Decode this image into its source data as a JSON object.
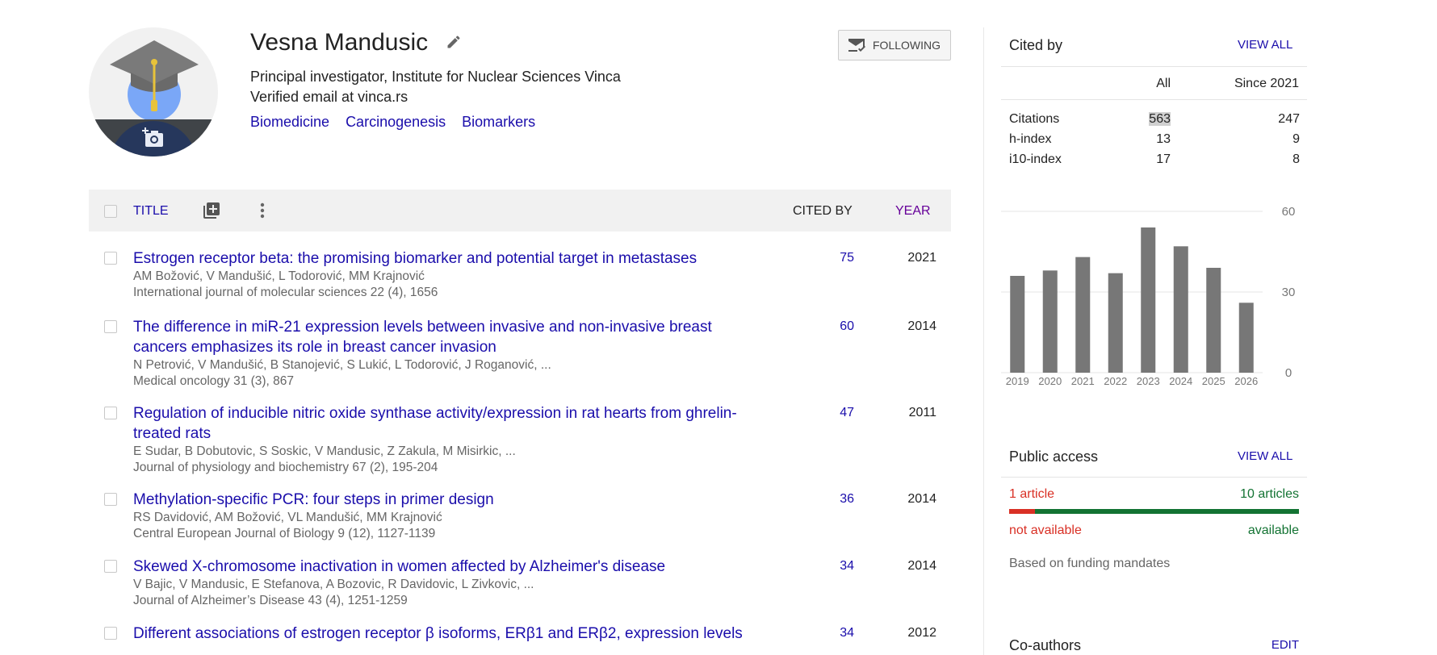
{
  "profile": {
    "name": "Vesna Mandusic",
    "affiliation": "Principal investigator, Institute for Nuclear Sciences Vinca",
    "email": "Verified email at vinca.rs",
    "interests": [
      "Biomedicine",
      "Carcinogenesis",
      "Biomarkers"
    ],
    "follow_label": "FOLLOWING"
  },
  "table": {
    "title_header": "TITLE",
    "cited_by_header": "CITED BY",
    "year_header": "YEAR",
    "rows": [
      {
        "title": [
          "Estrogen receptor beta: the promising biomarker and potential target in metastases"
        ],
        "authors": "AM Božović, V Mandušić, L Todorović, MM Krajnović",
        "venue": "International journal of molecular sciences 22 (4), 1656",
        "cited_by": "75",
        "year": "2021"
      },
      {
        "title": [
          "The difference in miR-21 expression levels between invasive and non-invasive breast",
          "cancers emphasizes its role in breast cancer invasion"
        ],
        "authors": "N Petrović, V Mandušić, B Stanojević, S Lukić, L Todorović, J Roganović, ...",
        "venue": "Medical oncology 31 (3), 867",
        "cited_by": "60",
        "year": "2014"
      },
      {
        "title": [
          "Regulation of inducible nitric oxide synthase activity/expression in rat hearts from ghrelin-",
          "treated rats"
        ],
        "authors": "E Sudar, B Dobutovic, S Soskic, V Mandusic, Z Zakula, M Misirkic, ...",
        "venue": "Journal of physiology and biochemistry 67 (2), 195-204",
        "cited_by": "47",
        "year": "2011"
      },
      {
        "title": [
          "Methylation-specific PCR: four steps in primer design"
        ],
        "authors": "RS Davidović, AM Božović, VL Mandušić, MM Krajnović",
        "venue": "Central European Journal of Biology 9 (12), 1127-1139",
        "cited_by": "36",
        "year": "2014"
      },
      {
        "title": [
          "Skewed X-chromosome inactivation in women affected by Alzheimer's disease"
        ],
        "authors": "V Bajic, V Mandusic, E Stefanova, A Bozovic, R Davidovic, L Zivkovic, ...",
        "venue": "Journal of Alzheimer’s Disease 43 (4), 1251-1259",
        "cited_by": "34",
        "year": "2014"
      },
      {
        "title": [
          "Different associations of estrogen receptor β isoforms, ERβ1 and ERβ2, expression levels"
        ],
        "authors": "",
        "venue": "",
        "cited_by": "34",
        "year": "2012"
      }
    ]
  },
  "cited_by": {
    "title": "Cited by",
    "view_all": "VIEW ALL",
    "col_all": "All",
    "col_since": "Since 2021",
    "stats": [
      {
        "label": "Citations",
        "all": "563",
        "since": "247"
      },
      {
        "label": "h-index",
        "all": "13",
        "since": "9"
      },
      {
        "label": "i10-index",
        "all": "17",
        "since": "8"
      }
    ]
  },
  "chart_data": {
    "type": "bar",
    "categories": [
      "2019",
      "2020",
      "2021",
      "2022",
      "2023",
      "2024",
      "2025",
      "2026"
    ],
    "values": [
      36,
      38,
      43,
      37,
      54,
      47,
      39,
      26
    ],
    "ylim": [
      0,
      60
    ],
    "yticks": [
      "0",
      "30",
      "60"
    ],
    "grid": true,
    "bar_color": "#777777"
  },
  "public_access": {
    "title": "Public access",
    "view_all": "VIEW ALL",
    "not_available_count": "1 article",
    "available_count": "10 articles",
    "not_available_label": "not available",
    "available_label": "available",
    "fraction_not_available": 0.09,
    "note": "Based on funding mandates"
  },
  "coauthors": {
    "title": "Co-authors",
    "edit": "EDIT"
  },
  "colors": {
    "link": "#1a0dab",
    "year_header": "#660099",
    "not_available": "#d93025",
    "available": "#137333"
  }
}
